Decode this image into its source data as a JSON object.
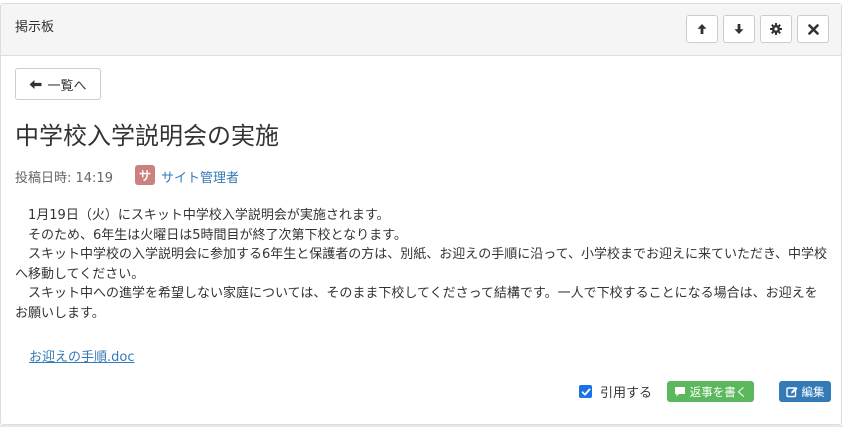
{
  "panel": {
    "title": "掲示板",
    "header_buttons": [
      "arrow-up-icon",
      "arrow-down-icon",
      "gear-icon",
      "close-icon"
    ]
  },
  "post": {
    "back_label": "一覧へ",
    "title": "中学校入学説明会の実施",
    "posted_label": "投稿日時: 14:19",
    "author_initial": "サ",
    "author_name": "サイト管理者",
    "body": [
      "　1月19日（火）にスキット中学校入学説明会が実施されます。",
      "　そのため、6年生は火曜日は5時間目が終了次第下校となります。",
      "　スキット中学校の入学説明会に参加する6年生と保護者の方は、別紙、お迎えの手順に沿って、小学校までお迎えに来ていただき、中学校へ移動してください。",
      "　スキット中への進学を希望しない家庭については、そのまま下校してくださって結構です。一人で下校することになる場合は、お迎えをお願いします。"
    ],
    "attachment": "お迎えの手順.doc"
  },
  "actions": {
    "quote_label": "引用する",
    "quote_checked": true,
    "reply_label": "返事を書く",
    "edit_label": "編集"
  },
  "colors": {
    "reply": "#5cb85c",
    "edit": "#337ab7",
    "link": "#337ab7",
    "avatar": "#c9827e"
  }
}
